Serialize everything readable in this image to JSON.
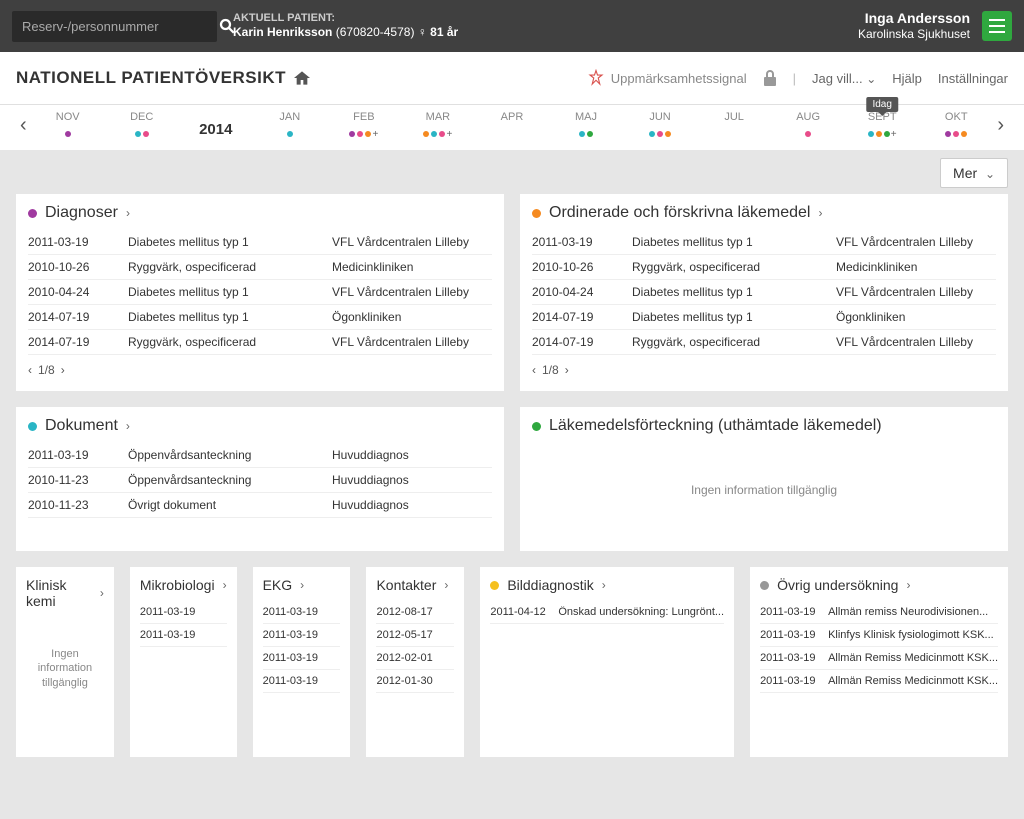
{
  "header": {
    "search_placeholder": "Reserv-/personnummer",
    "current_patient_label": "AKTUELL PATIENT:",
    "patient_name": "Karin Henriksson",
    "patient_id": "670820-4578",
    "patient_age": "81 år",
    "gender_symbol": "♀",
    "user_name": "Inga Andersson",
    "hospital": "Karolinska Sjukhuset"
  },
  "subbar": {
    "title": "NATIONELL PATIENTÖVERSIKT",
    "attention_label": "Uppmärksamhetssignal",
    "jag_vill": "Jag vill...",
    "help": "Hjälp",
    "settings": "Inställningar"
  },
  "timeline": {
    "today_label": "Idag",
    "year": "2014",
    "months": [
      "NOV",
      "DEC",
      "JAN",
      "FEB",
      "MAR",
      "APR",
      "MAJ",
      "JUN",
      "JUL",
      "AUG",
      "SEPT",
      "OKT"
    ]
  },
  "mer_label": "Mer",
  "cards": {
    "diag": {
      "title": "Diagnoser",
      "color": "#a03aa0",
      "pager": "1/8",
      "rows": [
        {
          "d": "2011-03-19",
          "t": "Diabetes mellitus typ 1",
          "p": "VFL Vårdcentralen Lilleby"
        },
        {
          "d": "2010-10-26",
          "t": "Ryggvärk, ospecificerad",
          "p": "Medicinkliniken"
        },
        {
          "d": "2010-04-24",
          "t": "Diabetes mellitus typ 1",
          "p": "VFL Vårdcentralen Lilleby"
        },
        {
          "d": "2014-07-19",
          "t": "Diabetes mellitus typ 1",
          "p": "Ögonkliniken"
        },
        {
          "d": "2014-07-19",
          "t": "Ryggvärk, ospecificerad",
          "p": "VFL Vårdcentralen Lilleby"
        }
      ]
    },
    "meds": {
      "title": "Ordinerade och förskrivna läkemedel",
      "color": "#f58a20",
      "pager": "1/8",
      "rows": [
        {
          "d": "2011-03-19",
          "t": "Diabetes mellitus typ 1",
          "p": "VFL Vårdcentralen Lilleby"
        },
        {
          "d": "2010-10-26",
          "t": "Ryggvärk, ospecificerad",
          "p": "Medicinkliniken"
        },
        {
          "d": "2010-04-24",
          "t": "Diabetes mellitus typ 1",
          "p": "VFL Vårdcentralen Lilleby"
        },
        {
          "d": "2014-07-19",
          "t": "Diabetes mellitus typ 1",
          "p": "Ögonkliniken"
        },
        {
          "d": "2014-07-19",
          "t": "Ryggvärk, ospecificerad",
          "p": "VFL Vårdcentralen Lilleby"
        }
      ]
    },
    "dok": {
      "title": "Dokument",
      "color": "#2ab5c5",
      "rows": [
        {
          "d": "2011-03-19",
          "t": "Öppenvårdsanteckning",
          "p": "Huvuddiagnos"
        },
        {
          "d": "2010-11-23",
          "t": "Öppenvårdsanteckning",
          "p": "Huvuddiagnos"
        },
        {
          "d": "2010-11-23",
          "t": "Övrigt dokument",
          "p": "Huvuddiagnos"
        }
      ]
    },
    "lak": {
      "title": "Läkemedelsförteckning (uthämtade läkemedel)",
      "color": "#2fa83f",
      "empty": "Ingen information tillgänglig"
    }
  },
  "bottom": {
    "kem": {
      "title": "Klinisk kemi",
      "empty": "Ingen information tillgänglig"
    },
    "mikro": {
      "title": "Mikrobiologi",
      "rows": [
        {
          "d": "2011-03-19"
        },
        {
          "d": "2011-03-19"
        }
      ]
    },
    "ekg": {
      "title": "EKG",
      "rows": [
        {
          "d": "2011-03-19"
        },
        {
          "d": "2011-03-19"
        },
        {
          "d": "2011-03-19"
        },
        {
          "d": "2011-03-19"
        }
      ]
    },
    "kont": {
      "title": "Kontakter",
      "rows": [
        {
          "d": "2012-08-17"
        },
        {
          "d": "2012-05-17"
        },
        {
          "d": "2012-02-01"
        },
        {
          "d": "2012-01-30"
        }
      ]
    },
    "bild": {
      "title": "Bilddiagnostik",
      "color": "#f5c020",
      "rows": [
        {
          "d": "2011-04-12",
          "t": "Önskad undersökning: Lungrönt..."
        }
      ]
    },
    "ovr": {
      "title": "Övrig undersökning",
      "color": "#999",
      "rows": [
        {
          "d": "2011-03-19",
          "t": "Allmän remiss Neurodivisionen..."
        },
        {
          "d": "2011-03-19",
          "t": "Klinfys Klinisk fysiologimott KSK..."
        },
        {
          "d": "2011-03-19",
          "t": "Allmän Remiss Medicinmott KSK..."
        },
        {
          "d": "2011-03-19",
          "t": "Allmän Remiss Medicinmott KSK..."
        }
      ]
    }
  }
}
